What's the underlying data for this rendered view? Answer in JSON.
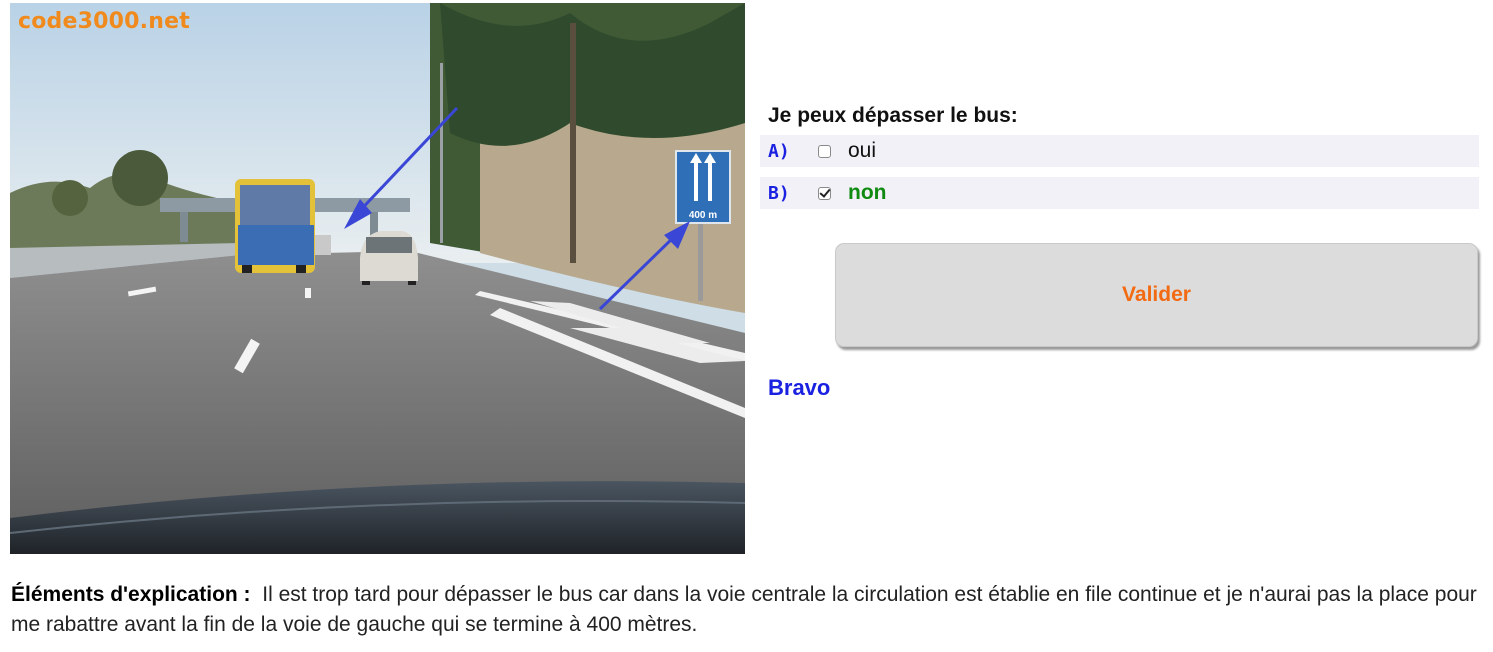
{
  "photo": {
    "watermark": "code3000.net",
    "sign_text": "400 m"
  },
  "quiz": {
    "question": "Je peux dépasser le bus:",
    "answers": [
      {
        "letter": "A)",
        "text": "oui",
        "checked": false
      },
      {
        "letter": "B)",
        "text": "non",
        "checked": true
      }
    ],
    "validate_label": "Valider",
    "feedback": "Bravo"
  },
  "explanation": {
    "label": "Éléments d'explication :",
    "text": "Il est trop tard pour dépasser le bus car dans la voie centrale la circulation est établie en file continue et je n'aurai pas la place pour me rabattre avant la fin de la voie de gauche qui se termine à 400 mètres."
  },
  "colors": {
    "accent_blue": "#1a21e0",
    "correct_green": "#118a11",
    "button_text_orange": "#f26a12",
    "watermark_orange": "#f08a1c"
  }
}
